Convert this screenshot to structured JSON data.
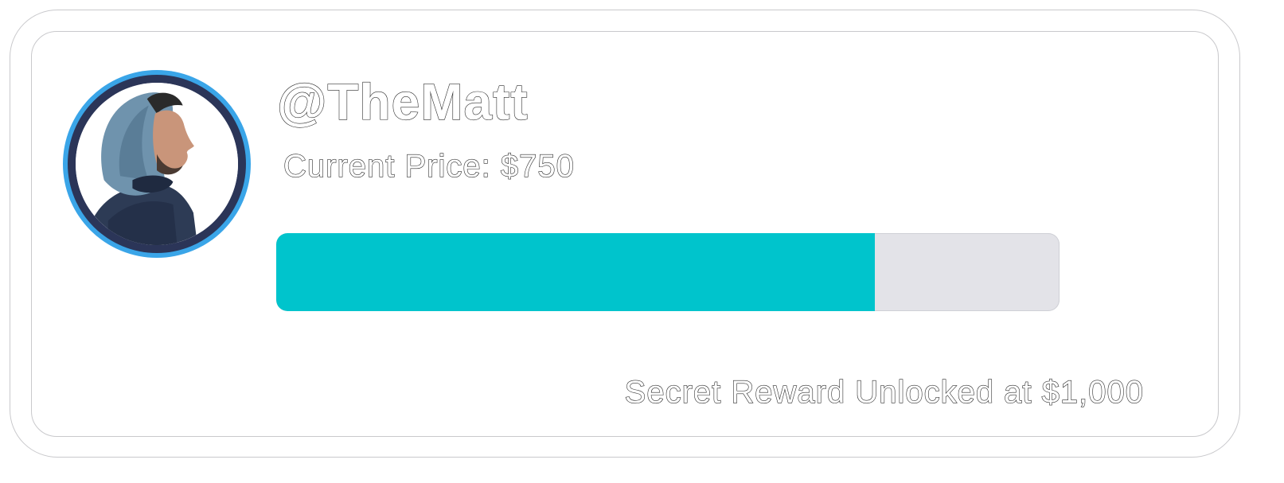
{
  "card": {
    "username": "@TheMatt",
    "price_text": "Current Price: $750",
    "progress": {
      "current": 750,
      "goal": 1000,
      "fraction": 0.764,
      "fill_color": "#00c4cc",
      "track_color": "#e3e3e8"
    },
    "reward_text": "Secret Reward Unlocked at $1,000",
    "avatar": {
      "ring_outer_color": "#3aa5e8",
      "ring_inner_color": "#2b3558",
      "icon": "profile-photo"
    }
  }
}
